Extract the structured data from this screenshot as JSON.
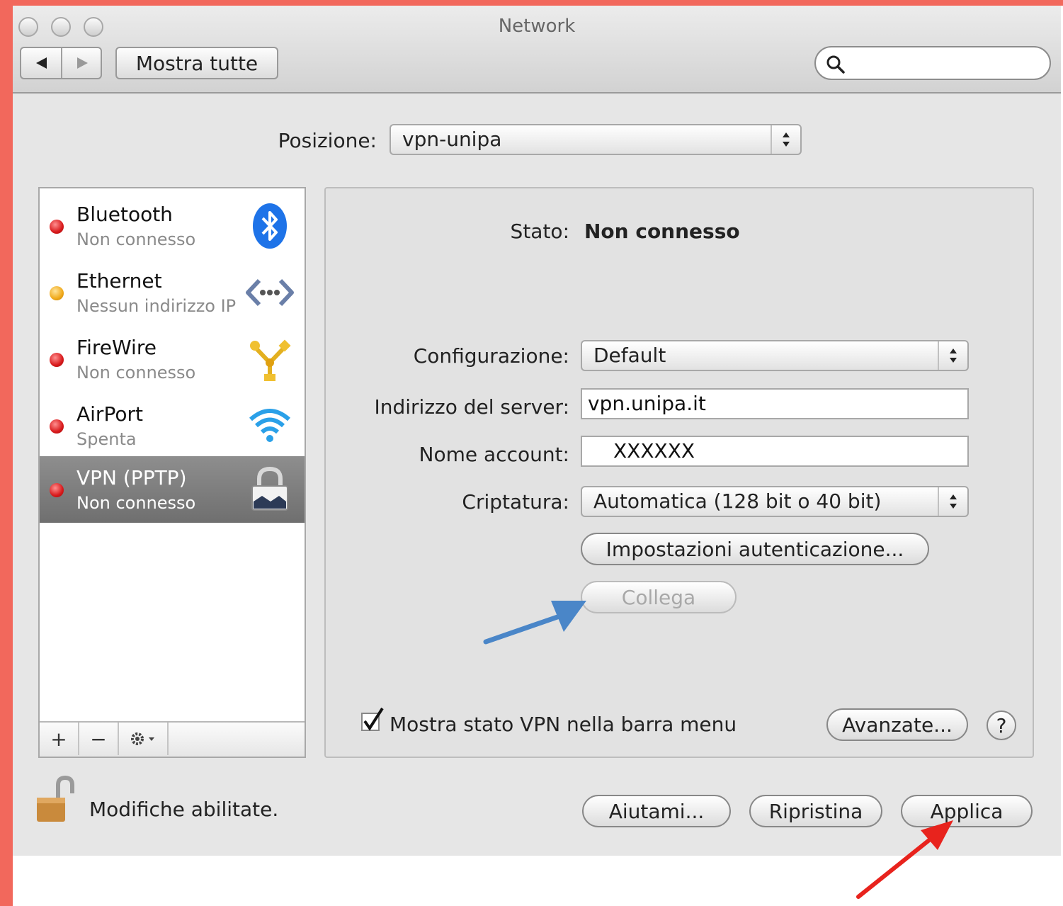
{
  "window": {
    "title": "Network"
  },
  "toolbar": {
    "back_icon": "back-arrow-icon",
    "forward_icon": "forward-arrow-icon",
    "show_all_label": "Mostra tutte",
    "search_icon": "magnifier-icon"
  },
  "location": {
    "label": "Posizione:",
    "value": "vpn-unipa"
  },
  "services": [
    {
      "name": "Bluetooth",
      "status": "Non connesso",
      "status_color": "#d8191b",
      "icon": "bluetooth-icon",
      "selected": false
    },
    {
      "name": "Ethernet",
      "status": "Nessun indirizzo IP",
      "status_color": "#f0a91a",
      "icon": "ethernet-icon",
      "selected": false
    },
    {
      "name": "FireWire",
      "status": "Non connesso",
      "status_color": "#d8191b",
      "icon": "firewire-icon",
      "selected": false
    },
    {
      "name": "AirPort",
      "status": "Spenta",
      "status_color": "#d8191b",
      "icon": "wifi-icon",
      "selected": false
    },
    {
      "name": "VPN (PPTP)",
      "status": "Non connesso",
      "status_color": "#d8191b",
      "icon": "padlock-icon",
      "selected": true
    }
  ],
  "sidebar_toolbar": {
    "add": "+",
    "remove": "−",
    "action_icon": "gear-icon"
  },
  "detail": {
    "status_label": "Stato:",
    "status_value": "Non connesso",
    "config_label": "Configurazione:",
    "config_value": "Default",
    "server_label": "Indirizzo del server:",
    "server_value": "vpn.unipa.it",
    "account_label": "Nome account:",
    "account_value": "XXXXXX",
    "encryption_label": "Criptatura:",
    "encryption_value": "Automatica (128 bit o 40 bit)",
    "auth_button": "Impostazioni autenticazione...",
    "connect_button": "Collega",
    "show_vpn_status_label": "Mostra stato VPN nella barra menu",
    "show_vpn_status_checked": true,
    "advanced_button": "Avanzate...",
    "help_button": "?"
  },
  "footer": {
    "lock_icon": "unlocked-padlock-icon",
    "lock_label": "Modifiche abilitate.",
    "assist_button": "Aiutami...",
    "revert_button": "Ripristina",
    "apply_button": "Applica"
  },
  "annotations": {
    "blue_arrow_color": "#4a86c8",
    "red_arrow_color": "#e8231d"
  }
}
